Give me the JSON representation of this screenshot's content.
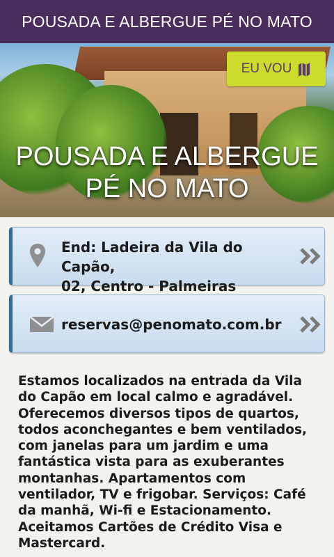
{
  "header": {
    "title": "POUSADA E ALBERGUE PÉ NO MATO"
  },
  "hero": {
    "title_line1": "POUSADA E ALBERGUE",
    "title_line2": "PÉ NO MATO",
    "eu_vou_label": "EU VOU"
  },
  "contacts": {
    "address": {
      "line1": "End: Ladeira da Vila do Capão,",
      "line2": "02, Centro - Palmeiras",
      "icon": "map-pin-icon"
    },
    "email": {
      "text": "reservas@penomato.com.br",
      "icon": "envelope-icon"
    }
  },
  "description": "Estamos localizados na entrada da Vila do Capão em local calmo e agradável. Oferecemos diversos tipos de quartos, todos aconchegantes e bem ventilados, com janelas para um jardim e uma fantástica vista para as exuberantes montanhas. Apartamentos com ventilador, TV e frigobar. Serviços: Café da manhã, Wi-fi e Estacionamento.  Aceitamos Cartões de Crédito Visa e Mastercard.",
  "colors": {
    "header_bg": "#4b2d5d",
    "button_bg": "#cbdc2d",
    "card_accent": "#2b6ea3"
  }
}
